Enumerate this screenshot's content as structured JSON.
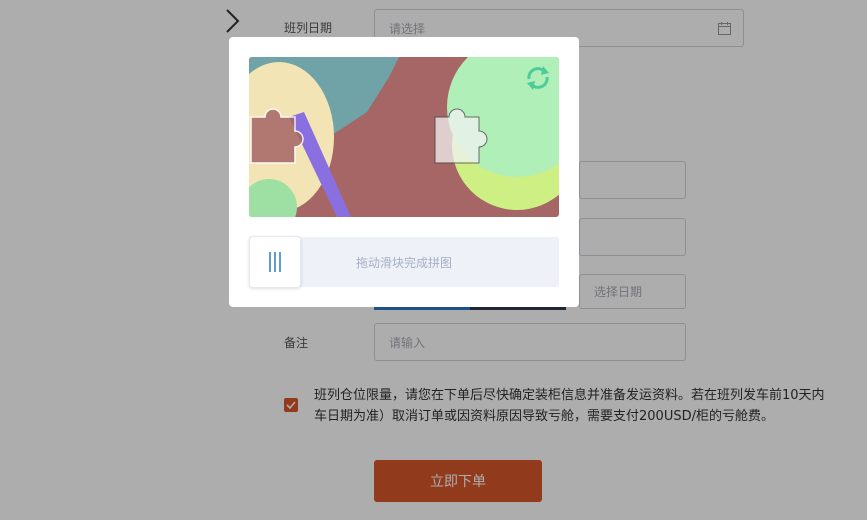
{
  "form": {
    "date_label": "班列日期",
    "date_placeholder": "请选择",
    "pick_date_placeholder": "选择日期",
    "remark_label": "备注",
    "remark_placeholder": "请输入"
  },
  "notice": {
    "checked": true,
    "line1": "班列仓位限量，请您在下单后尽快确定装柜信息并准备发运资料。若在班列发车前10天内",
    "line2": "车日期为准）取消订单或因资料原因导致亏舱，需要支付200USD/柜的亏舱费。"
  },
  "submit_label": "立即下单",
  "captcha": {
    "slider_hint": "拖动滑块完成拼图"
  },
  "colors": {
    "accent": "#d8582a",
    "overlay": "rgba(0,0,0,0.32)",
    "slider_bg": "#eef1f7"
  }
}
